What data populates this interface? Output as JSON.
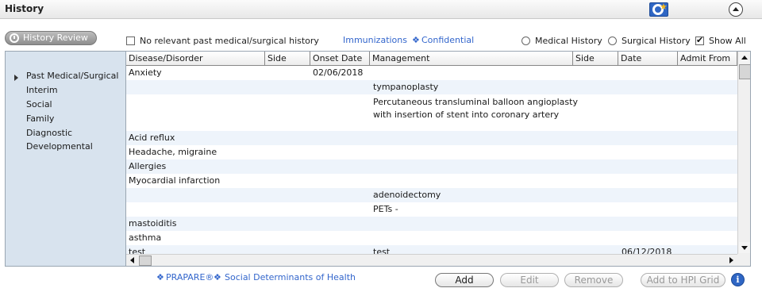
{
  "header": {
    "title": "History",
    "info_glyph": "i"
  },
  "toolbar": {
    "history_review": "History Review",
    "no_relevant": "No relevant past medical/surgical history",
    "immunizations": "Immunizations",
    "confidential": "Confidential",
    "medical_history": "Medical History",
    "surgical_history": "Surgical History",
    "show_all": "Show All",
    "show_all_checked": true
  },
  "sidebar": {
    "items": [
      {
        "label": "Past Medical/Surgical",
        "selected": true
      },
      {
        "label": "Interim"
      },
      {
        "label": "Social"
      },
      {
        "label": "Family"
      },
      {
        "label": "Diagnostic"
      },
      {
        "label": "Developmental"
      }
    ]
  },
  "grid": {
    "columns": [
      "Disease/Disorder",
      "Side",
      "Onset Date",
      "Management",
      "Side",
      "Date",
      "Admit From"
    ],
    "rows": [
      {
        "disease": "Anxiety",
        "side": "",
        "onset": "02/06/2018",
        "management": "",
        "side2": "",
        "date": ""
      },
      {
        "disease": "",
        "side": "",
        "onset": "",
        "management": "tympanoplasty",
        "side2": "",
        "date": ""
      },
      {
        "disease": "",
        "side": "",
        "onset": "",
        "management": "Percutaneous transluminal balloon angioplasty",
        "management2": "with insertion of stent into coronary artery",
        "side2": "",
        "date": ""
      },
      {
        "disease": "Acid reflux",
        "side": "",
        "onset": "",
        "management": "",
        "side2": "",
        "date": ""
      },
      {
        "disease": "Headache, migraine",
        "side": "",
        "onset": "",
        "management": "",
        "side2": "",
        "date": ""
      },
      {
        "disease": "Allergies",
        "side": "",
        "onset": "",
        "management": "",
        "side2": "",
        "date": ""
      },
      {
        "disease": "Myocardial infarction",
        "side": "",
        "onset": "",
        "management": "",
        "side2": "",
        "date": ""
      },
      {
        "disease": "",
        "side": "",
        "onset": "",
        "management": "adenoidectomy",
        "side2": "",
        "date": ""
      },
      {
        "disease": "",
        "side": "",
        "onset": "",
        "management": "PETs -",
        "side2": "",
        "date": ""
      },
      {
        "disease": "mastoiditis",
        "side": "",
        "onset": "",
        "management": "",
        "side2": "",
        "date": ""
      },
      {
        "disease": "asthma",
        "side": "",
        "onset": "",
        "management": "",
        "side2": "",
        "date": ""
      },
      {
        "disease": "test",
        "side": "",
        "onset": "",
        "management": "test",
        "side2": "",
        "date": "06/12/2018"
      }
    ]
  },
  "footer": {
    "prapare": "PRAPARE®",
    "sdoh": "Social Determinants of Health",
    "add": "Add",
    "edit": "Edit",
    "remove": "Remove",
    "add_to_hpi": "Add to HPI Grid"
  }
}
